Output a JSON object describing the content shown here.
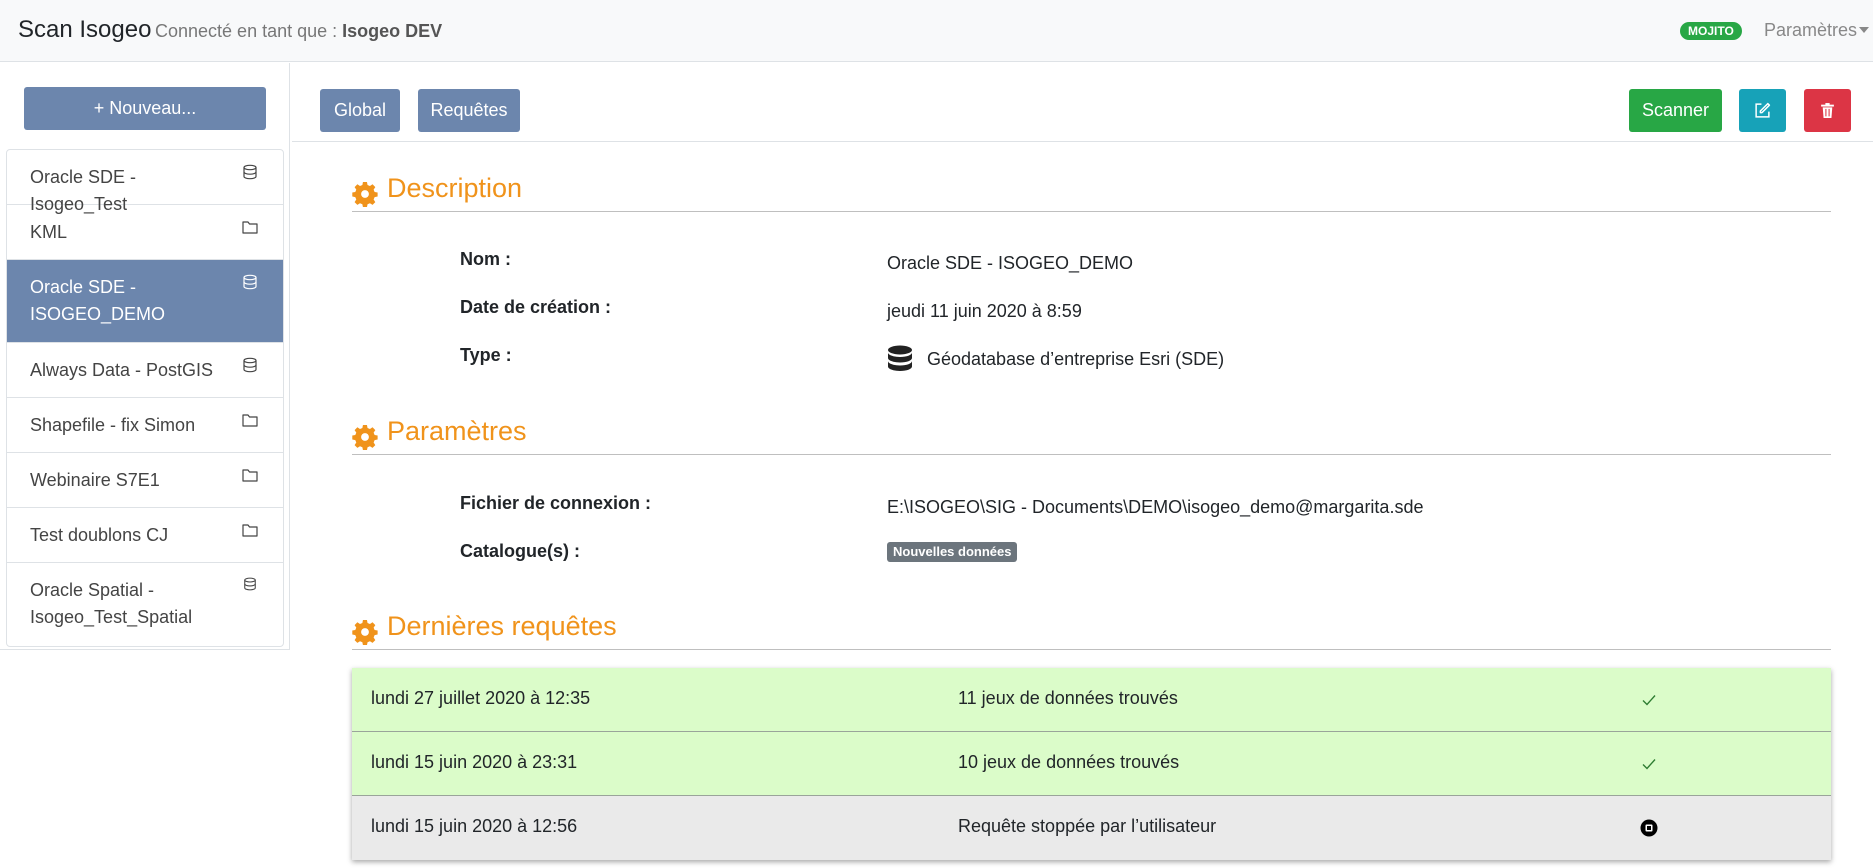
{
  "navbar": {
    "brand": "Scan Isogeo",
    "connected_prefix": "Connecté en tant que : ",
    "connected_user": "Isogeo DEV",
    "env_badge": "MOJITO",
    "params_menu": "Paramètres"
  },
  "sidebar": {
    "new_button": "+ Nouveau...",
    "items": [
      {
        "label": "Oracle SDE - Isogeo_Test",
        "icon": "database-icon"
      },
      {
        "label": "KML",
        "icon": "folder-icon"
      },
      {
        "label": "Oracle SDE - ISOGEO_DEMO",
        "icon": "database-icon",
        "active": true
      },
      {
        "label": "Always Data - PostGIS",
        "icon": "database-icon"
      },
      {
        "label": "Shapefile - fix Simon",
        "icon": "folder-icon"
      },
      {
        "label": "Webinaire S7E1",
        "icon": "folder-icon"
      },
      {
        "label": "Test doublons CJ",
        "icon": "folder-icon"
      },
      {
        "label": "Oracle Spatial - Isogeo_Test_Spatial",
        "icon": "database-icon"
      }
    ]
  },
  "toolbar": {
    "global": "Global",
    "requests": "Requêtes",
    "scan": "Scanner",
    "edit_icon": "edit-icon",
    "delete_icon": "trash-icon"
  },
  "description": {
    "title": "Description",
    "name_label": "Nom :",
    "name_value": "Oracle SDE - ISOGEO_DEMO",
    "date_label": "Date de création :",
    "date_value": "jeudi 11 juin 2020 à 8:59",
    "type_label": "Type :",
    "type_value": "Géodatabase d’entreprise Esri (SDE)"
  },
  "parameters": {
    "title": "Paramètres",
    "file_label": "Fichier de connexion :",
    "file_value": "E:\\ISOGEO\\SIG - Documents\\DEMO\\isogeo_demo@margarita.sde",
    "catalog_label": "Catalogue(s) :",
    "catalog_badge": "Nouvelles données"
  },
  "requests": {
    "title": "Dernières requêtes",
    "rows": [
      {
        "date": "lundi 27 juillet 2020 à 12:35",
        "message": "11 jeux de données trouvés",
        "status": "success"
      },
      {
        "date": "lundi 15 juin 2020 à 23:31",
        "message": "10 jeux de données trouvés",
        "status": "success"
      },
      {
        "date": "lundi 15 juin 2020 à 12:56",
        "message": "Requête stoppée par l’utilisateur",
        "status": "stopped"
      }
    ]
  },
  "colors": {
    "accent": "#f0931b",
    "primary": "#6c86ad",
    "success": "#28a745",
    "info": "#17a2b8",
    "danger": "#dc3545",
    "row_success": "#dbfcc9",
    "row_stopped": "#eaeaea"
  }
}
